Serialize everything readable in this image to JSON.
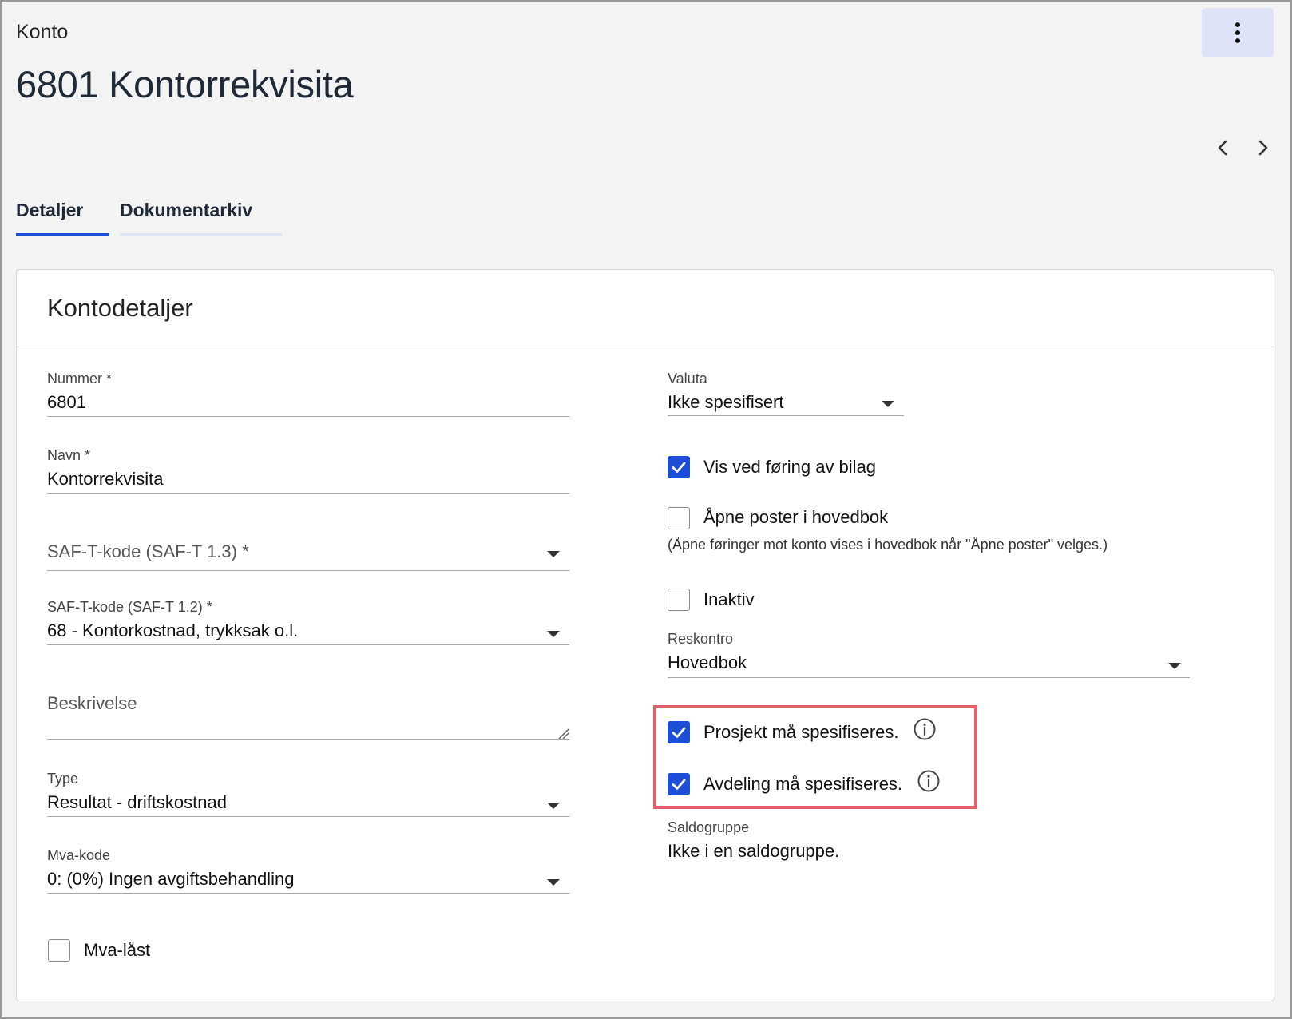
{
  "header": {
    "breadcrumb": "Konto",
    "title": "6801 Kontorrekvisita",
    "more_icon": "more-vertical-icon",
    "prev_icon": "chevron-left-icon",
    "next_icon": "chevron-right-icon"
  },
  "tabs": [
    {
      "label": "Detaljer",
      "active": true
    },
    {
      "label": "Dokumentarkiv",
      "active": false
    }
  ],
  "colors": {
    "accent": "#1d4ed8",
    "highlight": "#e0606e"
  },
  "card": {
    "title": "Kontodetaljer",
    "left": {
      "nummer": {
        "label": "Nummer *",
        "value": "6801"
      },
      "navn": {
        "label": "Navn *",
        "value": "Kontorrekvisita"
      },
      "saft13": {
        "placeholder": "SAF-T-kode (SAF-T 1.3) *"
      },
      "saft12": {
        "label": "SAF-T-kode (SAF-T 1.2) *",
        "value": "68 - Kontorkostnad, trykksak o.l."
      },
      "beskrivelse": {
        "placeholder": "Beskrivelse"
      },
      "type": {
        "label": "Type",
        "value": "Resultat - driftskostnad"
      },
      "mva_kode": {
        "label": "Mva-kode",
        "value": "0: (0%) Ingen avgiftsbehandling"
      },
      "mva_last": {
        "label": "Mva-låst",
        "checked": false
      }
    },
    "right": {
      "valuta": {
        "label": "Valuta",
        "value": "Ikke spesifisert"
      },
      "vis_ved_foring": {
        "label": "Vis ved føring av bilag",
        "checked": true
      },
      "apne_poster": {
        "label": "Åpne poster i hovedbok",
        "checked": false
      },
      "apne_poster_hint": "(Åpne føringer mot konto vises i hovedbok når \"Åpne poster\" velges.)",
      "inaktiv": {
        "label": "Inaktiv",
        "checked": false
      },
      "reskontro": {
        "label": "Reskontro",
        "value": "Hovedbok"
      },
      "prosjekt": {
        "label": "Prosjekt må spesifiseres.",
        "checked": true
      },
      "avdeling": {
        "label": "Avdeling må spesifiseres.",
        "checked": true
      },
      "saldogruppe": {
        "label": "Saldogruppe",
        "value": "Ikke i en saldogruppe."
      }
    }
  }
}
